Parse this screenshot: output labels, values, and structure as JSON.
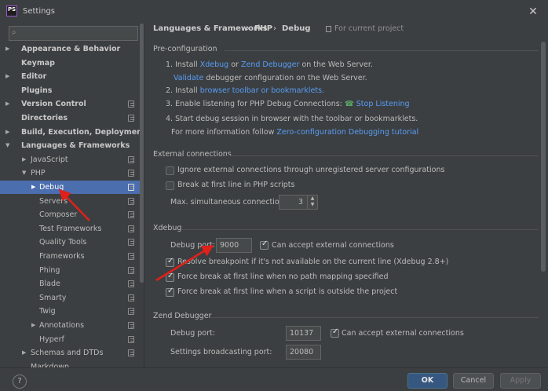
{
  "window": {
    "icon_text": "PS",
    "title": "Settings",
    "close_icon": "close-icon"
  },
  "search": {
    "placeholder": "",
    "icon": "search-icon"
  },
  "tree": [
    {
      "label": "Appearance & Behavior",
      "level": 0,
      "arrow": "▶",
      "bold": true,
      "copy": false,
      "selected": false
    },
    {
      "label": "Keymap",
      "level": 0,
      "arrow": "",
      "bold": true,
      "copy": false,
      "selected": false
    },
    {
      "label": "Editor",
      "level": 0,
      "arrow": "▶",
      "bold": true,
      "copy": false,
      "selected": false
    },
    {
      "label": "Plugins",
      "level": 0,
      "arrow": "",
      "bold": true,
      "copy": false,
      "selected": false
    },
    {
      "label": "Version Control",
      "level": 0,
      "arrow": "▶",
      "bold": true,
      "copy": true,
      "selected": false
    },
    {
      "label": "Directories",
      "level": 0,
      "arrow": "",
      "bold": true,
      "copy": true,
      "selected": false
    },
    {
      "label": "Build, Execution, Deployment",
      "level": 0,
      "arrow": "▶",
      "bold": true,
      "copy": false,
      "selected": false
    },
    {
      "label": "Languages & Frameworks",
      "level": 0,
      "arrow": "▼",
      "bold": true,
      "copy": false,
      "selected": false
    },
    {
      "label": "JavaScript",
      "level": 1,
      "arrow": "▶",
      "bold": false,
      "copy": true,
      "selected": false
    },
    {
      "label": "PHP",
      "level": 1,
      "arrow": "▼",
      "bold": false,
      "copy": true,
      "selected": false
    },
    {
      "label": "Debug",
      "level": 2,
      "arrow": "▶",
      "bold": false,
      "copy": true,
      "selected": true
    },
    {
      "label": "Servers",
      "level": 2,
      "arrow": "",
      "bold": false,
      "copy": true,
      "selected": false
    },
    {
      "label": "Composer",
      "level": 2,
      "arrow": "",
      "bold": false,
      "copy": true,
      "selected": false
    },
    {
      "label": "Test Frameworks",
      "level": 2,
      "arrow": "",
      "bold": false,
      "copy": true,
      "selected": false
    },
    {
      "label": "Quality Tools",
      "level": 2,
      "arrow": "",
      "bold": false,
      "copy": true,
      "selected": false
    },
    {
      "label": "Frameworks",
      "level": 2,
      "arrow": "",
      "bold": false,
      "copy": true,
      "selected": false
    },
    {
      "label": "Phing",
      "level": 2,
      "arrow": "",
      "bold": false,
      "copy": true,
      "selected": false
    },
    {
      "label": "Blade",
      "level": 2,
      "arrow": "",
      "bold": false,
      "copy": true,
      "selected": false
    },
    {
      "label": "Smarty",
      "level": 2,
      "arrow": "",
      "bold": false,
      "copy": true,
      "selected": false
    },
    {
      "label": "Twig",
      "level": 2,
      "arrow": "",
      "bold": false,
      "copy": true,
      "selected": false
    },
    {
      "label": "Annotations",
      "level": 2,
      "arrow": "▶",
      "bold": false,
      "copy": true,
      "selected": false
    },
    {
      "label": "Hyperf",
      "level": 2,
      "arrow": "",
      "bold": false,
      "copy": true,
      "selected": false
    },
    {
      "label": "Schemas and DTDs",
      "level": 1,
      "arrow": "▶",
      "bold": false,
      "copy": true,
      "selected": false
    },
    {
      "label": "Markdown",
      "level": 1,
      "arrow": "",
      "bold": false,
      "copy": false,
      "selected": false
    }
  ],
  "header": {
    "crumbs": [
      "Languages & Frameworks",
      "PHP",
      "Debug"
    ],
    "separator": "›",
    "scope": "For current project"
  },
  "pre": {
    "title": "Pre-configuration",
    "step1": {
      "a": "1. Install",
      "link1": "Xdebug",
      "or": "or",
      "link2": "Zend Debugger",
      "b": "on the Web Server."
    },
    "step1b": {
      "link": "Validate",
      "text": "debugger configuration on the Web Server."
    },
    "step2": {
      "text": "2. Install",
      "link": "browser toolbar or bookmarklets."
    },
    "step3": {
      "text": "3. Enable listening for PHP Debug Connections:",
      "link": "Stop Listening"
    },
    "step4": {
      "text": "4. Start debug session in browser with the toolbar or bookmarklets."
    },
    "step4b": {
      "text": "For more information follow",
      "link": "Zero-configuration Debugging tutorial"
    }
  },
  "external": {
    "title": "External connections",
    "ignore": {
      "label": "Ignore external connections through unregistered server configurations",
      "checked": false
    },
    "break": {
      "label": "Break at first line in PHP scripts",
      "checked": false
    },
    "max_label": "Max. simultaneous connections:",
    "max_value": "3"
  },
  "xdebug": {
    "title": "Xdebug",
    "port_label": "Debug port:",
    "port_value": "9000",
    "accept": {
      "label": "Can accept external connections",
      "checked": true
    },
    "resolve": {
      "label": "Resolve breakpoint if it's not available on the current line (Xdebug 2.8+)",
      "checked": true
    },
    "force_path": {
      "label": "Force break at first line when no path mapping specified",
      "checked": true
    },
    "force_outside": {
      "label": "Force break at first line when a script is outside the project",
      "checked": true
    }
  },
  "zend": {
    "title": "Zend Debugger",
    "port_label": "Debug port:",
    "port_value": "10137",
    "accept": {
      "label": "Can accept external connections",
      "checked": true
    },
    "broadcast_label": "Settings broadcasting port:",
    "broadcast_value": "20080"
  },
  "footer": {
    "help": "?",
    "ok": "OK",
    "cancel": "Cancel",
    "apply": "Apply"
  },
  "colors": {
    "background": "#3c3f41",
    "selection": "#4b6eaf",
    "link": "#589df6",
    "primary_button": "#365880",
    "annotation_arrow": "#e0201a"
  }
}
